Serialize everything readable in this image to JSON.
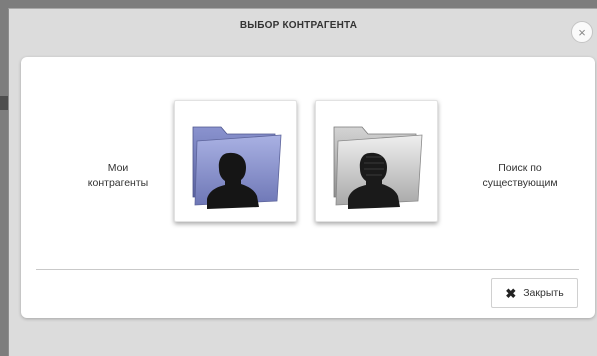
{
  "dialog": {
    "title": "ВЫБОР КОНТРАГЕНТА",
    "close_icon": "×"
  },
  "options": {
    "my": {
      "label": "Мои\nконтрагенты",
      "icon": "user-folder-blue-icon"
    },
    "search": {
      "label": "Поиск по\nсуществующим",
      "icon": "user-folder-gray-icon"
    }
  },
  "footer": {
    "close_label": "Закрыть",
    "close_icon": "✖"
  },
  "colors": {
    "folder_blue": "#8c95cf",
    "folder_gray": "#c9c9c9",
    "silhouette": "#1c1c1c"
  }
}
